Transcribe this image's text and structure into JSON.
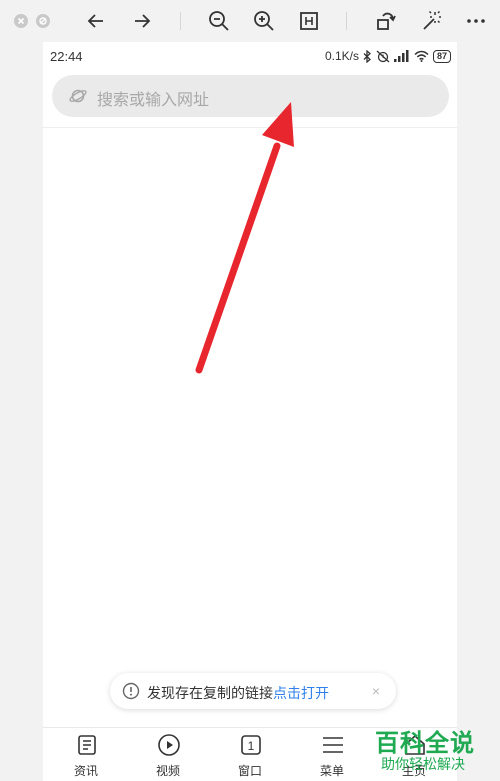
{
  "viewer": {
    "toolbar_icons": [
      "close-dot-icon",
      "minimize-dot-icon",
      "back-arrow-icon",
      "forward-arrow-icon",
      "zoom-out-icon",
      "zoom-in-icon",
      "fit-icon",
      "rotate-icon",
      "magic-wand-icon",
      "more-icon"
    ]
  },
  "status_bar": {
    "time": "22:44",
    "net_speed": "0.1K/s",
    "battery": "87",
    "icons": [
      "bluetooth-icon",
      "alarm-off-icon",
      "signal-icon",
      "wifi-icon",
      "battery-icon"
    ]
  },
  "search": {
    "placeholder": "搜索或输入网址",
    "icon": "planet-icon"
  },
  "annotation": {
    "color": "#e8262e",
    "shape": "arrow pointing to search bar"
  },
  "clipboard_toast": {
    "message": "发现存在复制的链接",
    "action": "点击打开",
    "close": "×"
  },
  "bottom_nav": {
    "items": [
      {
        "label": "资讯",
        "icon": "news-icon"
      },
      {
        "label": "视频",
        "icon": "video-play-icon"
      },
      {
        "label": "窗口",
        "icon": "window-count-icon",
        "count": "1"
      },
      {
        "label": "菜单",
        "icon": "menu-icon"
      },
      {
        "label": "主页",
        "icon": "home-icon"
      }
    ]
  },
  "watermark": {
    "title": "百科全说",
    "subtitle": "助你轻松解决"
  },
  "colors": {
    "accent_link": "#2f80ed",
    "watermark_green": "#1faa52",
    "arrow_red": "#e8262e"
  }
}
